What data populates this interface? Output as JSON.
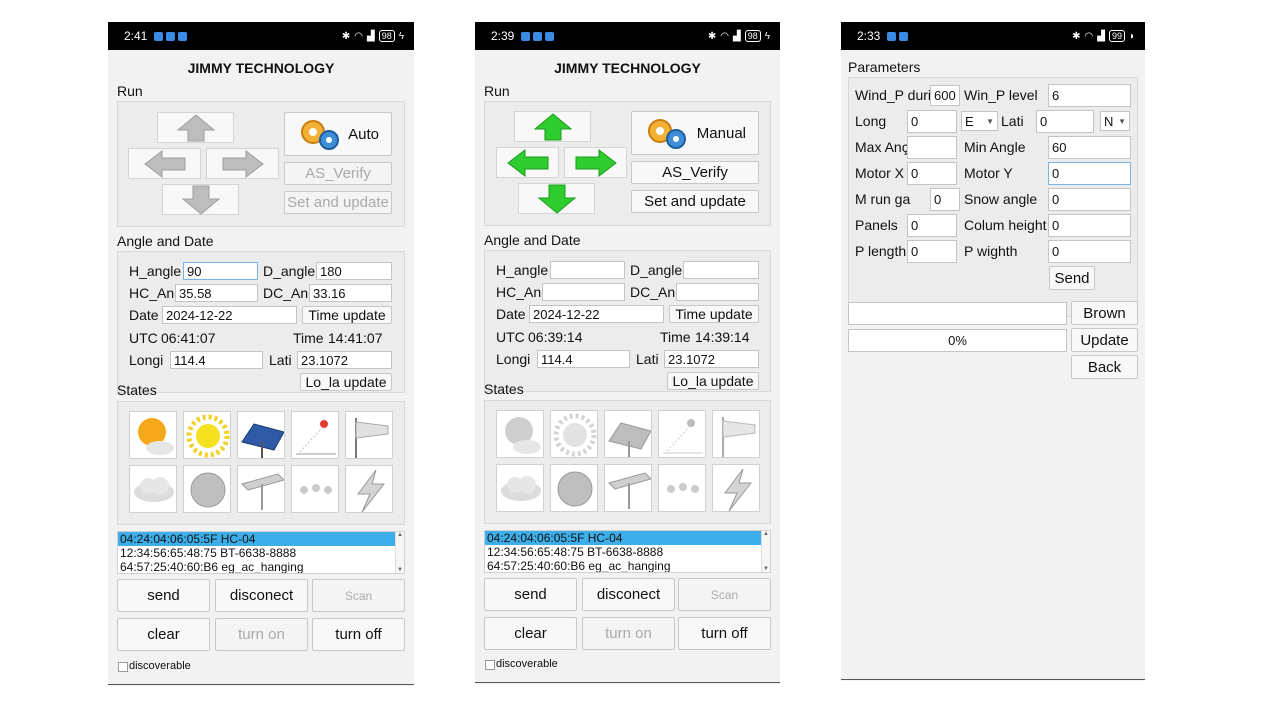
{
  "app_title": "JIMMY TECHNOLOGY",
  "common": {
    "run_label": "Run",
    "angle_date_label": "Angle and Date",
    "states_label": "States",
    "h_angle_label": "H_angle",
    "d_angle_label": "D_angle",
    "hc_an_label": "HC_An",
    "dc_an_label": "DC_An",
    "date_label": "Date",
    "utc_label": "UTC",
    "time_label": "Time",
    "longi_label": "Longi",
    "lati_label": "Lati",
    "time_update_btn": "Time update",
    "lo_la_update_btn": "Lo_la update",
    "as_verify_btn": "AS_Verify",
    "set_update_btn": "Set and update",
    "send_btn": "send",
    "disconnect_btn": "disconect",
    "scan_btn": "Scan",
    "clear_btn": "clear",
    "turn_on_btn": "turn on",
    "turn_off_btn": "turn off",
    "discoverable_label": "discoverable",
    "devices": [
      "04:24:04:06:05:5F HC-04",
      "12:34:56:65:48:75 BT-6638-8888",
      "64:57:25:40:60:B6 eg_ac_hanging"
    ]
  },
  "screen1": {
    "status_time": "2:41",
    "battery": "98",
    "mode_btn": "Auto",
    "h_angle": "90",
    "d_angle": "180",
    "hc_an": "35.58",
    "dc_an": "33.16",
    "date": "2024-12-22",
    "utc": "06:41:07",
    "time": "14:41:07",
    "longi": "114.4",
    "lati": "23.1072"
  },
  "screen2": {
    "status_time": "2:39",
    "battery": "98",
    "mode_btn": "Manual",
    "h_angle": "",
    "d_angle": "",
    "hc_an": "",
    "dc_an": "",
    "date": "2024-12-22",
    "utc": "06:39:14",
    "time": "14:39:14",
    "longi": "114.4",
    "lati": "23.1072"
  },
  "screen3": {
    "status_time": "2:33",
    "battery": "99",
    "title": "Parameters",
    "wind_p_dur_label": "Wind_P duri",
    "wind_p_dur": "600",
    "win_p_level_label": "Win_P level",
    "win_p_level": "6",
    "long_label": "Long",
    "long": "0",
    "long_dir": "E",
    "lati_label": "Lati",
    "lati": "0",
    "lati_dir": "N",
    "max_angle_label": "Max Anç",
    "max_angle": "",
    "min_angle_label": "Min Angle",
    "min_angle": "60",
    "motor_x_label": "Motor X",
    "motor_x": "0",
    "motor_y_label": "Motor Y",
    "motor_y": "0",
    "m_run_label": "M run ga",
    "m_run": "0",
    "snow_angle_label": "Snow angle",
    "snow_angle": "0",
    "panels_label": "Panels",
    "panels": "0",
    "colum_height_label": "Colum height",
    "colum_height": "0",
    "p_length_label": "P length",
    "p_length": "0",
    "p_wighth_label": "P wighth",
    "p_wighth": "0",
    "send_btn": "Send",
    "file_path": "",
    "brown_btn": "Brown",
    "progress_text": "0%",
    "progress": 0,
    "update_btn": "Update",
    "back_btn": "Back"
  },
  "colors": {
    "arrow_active": "#2ecc2e",
    "arrow_inactive": "#bdbdbd",
    "selection": "#3daee9",
    "focus": "#7ab3e6"
  }
}
